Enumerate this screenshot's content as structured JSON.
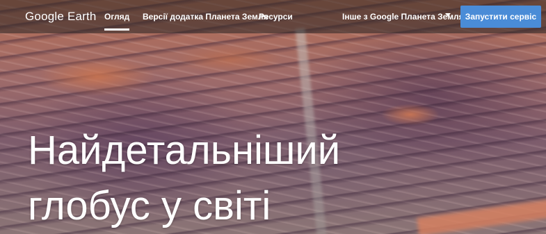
{
  "brand": {
    "name": "Google Earth"
  },
  "nav": {
    "items": [
      {
        "label": "Огляд",
        "active": true
      },
      {
        "label": "Версії додатка Планета Земля",
        "active": false
      },
      {
        "label": "Ресурси",
        "active": false
      }
    ],
    "more": {
      "label": "Інше з Google Планета Земля",
      "icon": "caret-down-icon"
    },
    "launch_button": {
      "label": "Запустити сервіс",
      "color": "#4a8cd7"
    }
  },
  "hero": {
    "line1": "Найдетальніший",
    "line2": "глобус у світі"
  }
}
